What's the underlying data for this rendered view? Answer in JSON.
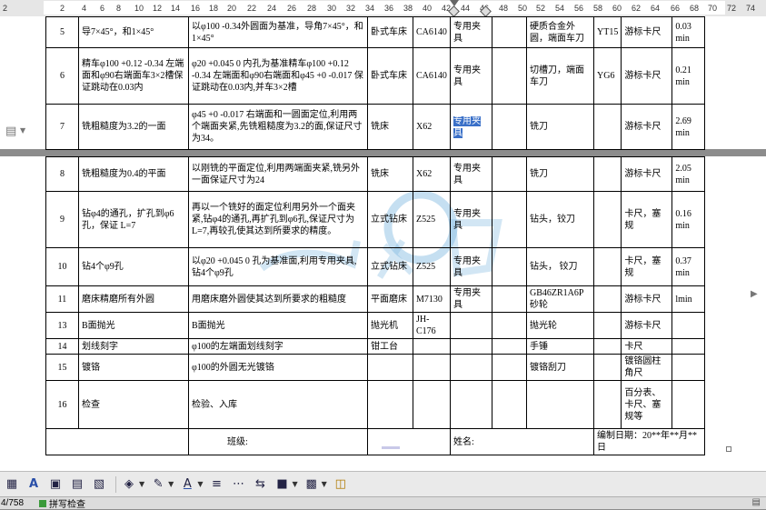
{
  "ruler": {
    "numbers": [
      "2",
      "2",
      "4",
      "6",
      "8",
      "10",
      "12",
      "14",
      "16",
      "18",
      "20",
      "22",
      "24",
      "26",
      "28",
      "30",
      "32",
      "34",
      "36",
      "38",
      "40",
      "42",
      "44",
      "46",
      "48",
      "50",
      "52",
      "54",
      "56",
      "58",
      "60",
      "62",
      "64",
      "66",
      "68",
      "70",
      "72",
      "74"
    ]
  },
  "table": {
    "rows": [
      {
        "no": "5",
        "name": "导7×45°，和1×45°",
        "content": "以φ100 -0.34外圆面为基准，导角7×45°，和1×45°",
        "machine": "卧式车床",
        "model": "CA6140",
        "fixture": "专用夹具",
        "tool": "硬质合金外圆，端面车刀",
        "material": "YT15",
        "gauge": "游标卡尺",
        "time": "0.03 min"
      },
      {
        "no": "6",
        "name": "精车φ100 +0.12 -0.34 左端面和φ90右端面车3×2槽保证跳动在0.03内",
        "content": "φ20 +0.045 0 内孔为基准精车φ100 +0.12 -0.34 左端面和φ90右端面和φ45 +0 -0.017 保证跳动在0.03内,并车3×2槽",
        "machine": "卧式车床",
        "model": "CA6140",
        "fixture": "专用夹具",
        "tool": "切槽刀，端面车刀",
        "material": "YG6",
        "gauge": "游标卡尺",
        "time": "0.21 min"
      },
      {
        "no": "7",
        "name": "铣粗糙度为3.2的一面",
        "content": "φ45 +0 -0.017 右端面和一圆面定位,利用两个端面夹紧,先铣粗糙度为3.2的面,保证尺寸为34。",
        "machine": "铣床",
        "model": "X62",
        "fixture_sel": "专用夹具",
        "tool": "铣刀",
        "material": "",
        "gauge": "游标卡尺",
        "time": "2.69 min"
      },
      {
        "no": "8",
        "name": "铣粗糙度为0.4的平面",
        "content": "以刚铣的平面定位,利用两端面夹紧,铣另外一面保证尺寸为24",
        "machine": "铣床",
        "model": "X62",
        "fixture": "专用夹具",
        "tool": "铣刀",
        "material": "",
        "gauge": "游标卡尺",
        "time": "2.05 min"
      },
      {
        "no": "9",
        "name": "钻φ4的通孔，扩孔到φ6孔，保证 L=7",
        "content": "再以一个铣好的面定位利用另外一个面夹紧,钻φ4的通孔,再扩孔到φ6孔,保证尺寸为L=7,再较孔使其达到所要求的精度。",
        "machine": "立式钻床",
        "model": "Z525",
        "fixture": "专用夹具",
        "tool": "钻头，铰刀",
        "material": "",
        "gauge": "卡尺，塞规",
        "time": "0.16 min"
      },
      {
        "no": "10",
        "name": "钻4个φ9孔",
        "content": "以φ20 +0.045 0 孔为基准面,利用专用夹具,钻4个φ9孔",
        "machine": "立式钻床",
        "model": "Z525",
        "fixture": "专用夹具",
        "tool": "钻头，  铰刀",
        "material": "",
        "gauge": "卡尺，塞规",
        "time": "0.37 min"
      },
      {
        "no": "11",
        "name": "磨床精磨所有外圆",
        "content": "用磨床磨外圆使其达到所要求的粗糙度",
        "machine": "平面磨床",
        "model": "M7130",
        "fixture": "专用夹具",
        "tool": "GB46ZR1A6P砂轮",
        "material": "",
        "gauge": "游标卡尺",
        "time": "lmin"
      },
      {
        "no": "13",
        "name": "B面抛光",
        "content": "B面抛光",
        "machine": "抛光机",
        "model": "JH-C176",
        "fixture": "",
        "tool": "抛光轮",
        "material": "",
        "gauge": "游标卡尺",
        "time": ""
      },
      {
        "no": "14",
        "name": "划线刻字",
        "content": "φ100的左端面划线刻字",
        "machine": "钳工台",
        "model": "",
        "fixture": "",
        "tool": "手锤",
        "material": "",
        "gauge": "卡尺",
        "time": ""
      },
      {
        "no": "15",
        "name": "镀铬",
        "content": "φ100的外圆无光镀铬",
        "machine": "",
        "model": "",
        "fixture": "",
        "tool": "镀铬刮刀",
        "material": "",
        "gauge": "镀铬圆柱角尺",
        "time": ""
      },
      {
        "no": "16",
        "name": "检查",
        "content": "检验、入库",
        "machine": "",
        "model": "",
        "fixture": "",
        "tool": "",
        "material": "",
        "gauge": "百分表、卡尺、塞规等",
        "time": ""
      }
    ],
    "footer": {
      "class_label": "班级:",
      "name_label": "姓名:",
      "date_label": "编制日期：20**年**月**日"
    }
  },
  "watermark": {
    "text": "人人文库",
    "color": "#7fb8e0"
  },
  "statusbar": {
    "page": "4/758",
    "spell": "拼写检查"
  },
  "colors": {
    "selection": "#3a70c8",
    "background": "#8c8c8c"
  }
}
